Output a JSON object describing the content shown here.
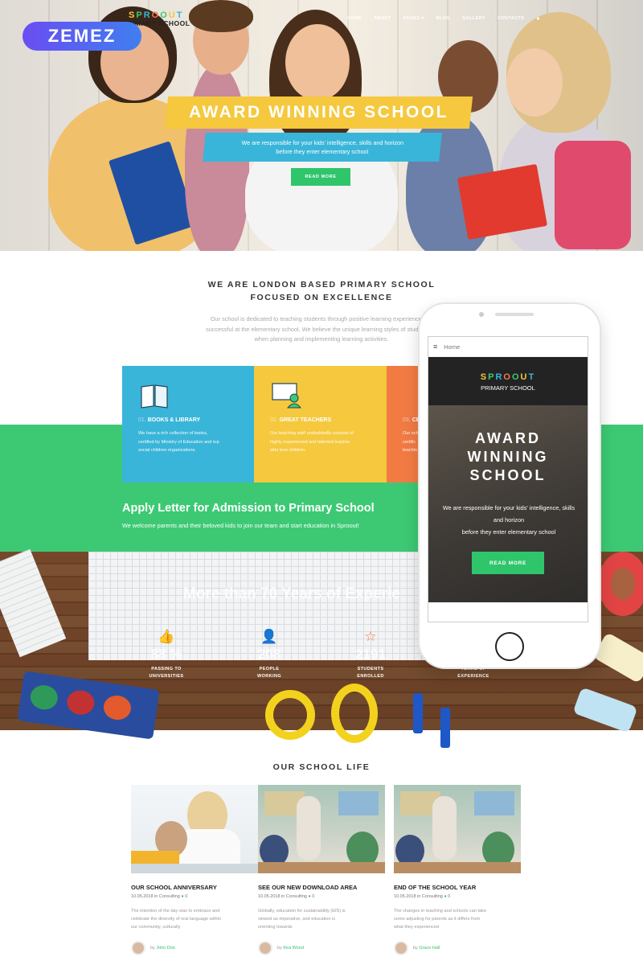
{
  "colors": {
    "green": "#3dc973",
    "yellow": "#f5c83e",
    "blue": "#39b5d9",
    "orange": "#f27b44",
    "zemez": "#5a5ff0"
  },
  "badge": {
    "text": "ZEMEZ"
  },
  "logo": {
    "letters": [
      "S",
      "P",
      "R",
      "O",
      "O",
      "U",
      "T"
    ],
    "letter_colors": [
      "#f5c83e",
      "#3dc973",
      "#39b5d9",
      "#f27b44",
      "#3dc973",
      "#f5c83e",
      "#39b5d9"
    ],
    "subtitle": "PRIMARY SCHOOL"
  },
  "nav": {
    "items": [
      "HOME",
      "ABOUT",
      "PAGES ▾",
      "BLOG",
      "GALLERY",
      "CONTACTS"
    ],
    "user_icon": "user-icon"
  },
  "hero": {
    "title": "AWARD WINNING SCHOOL",
    "sub_line1": "We are responsible for your kids' intelligence, skills and horizon",
    "sub_line2": "before they enter elementary school",
    "button": "READ MORE"
  },
  "about": {
    "title_line1": "WE ARE LONDON BASED PRIMARY SCHOOL",
    "title_line2": "FOCUSED ON EXCELLENCE",
    "text_line1": "Our school is dedicated to teaching students through positive learning experiences so",
    "text_line2": "successful at the elementary school. We believe the unique learning styles of students sh",
    "text_line3": "when planning and implementing learning activities."
  },
  "features": [
    {
      "num": "01.",
      "title": "BOOKS & LIBRARY",
      "line1": "We have a rich collection of books,",
      "line2": "certified by Ministry of Education and top",
      "line3": "social children organizations.",
      "icon": "book-icon"
    },
    {
      "num": "02.",
      "title": "GREAT TEACHERS",
      "line1": "Our teaching staff undoubtedly consists of",
      "line2": "highly experienced and talented teacher",
      "line3": "who love children.",
      "icon": "teacher-icon"
    },
    {
      "num": "03.",
      "title": "CE",
      "line1": "Our sch",
      "line2": "certific",
      "line3": "teachin",
      "icon": "award-icon"
    }
  ],
  "apply": {
    "title": "Apply Letter for Admission to Primary School",
    "text": "We welcome parents and their beloved kids to join our team and start education in Sproout!"
  },
  "experience": {
    "title": "More than 70 Years of Experie"
  },
  "stats": [
    {
      "value": "88 %",
      "label1": "PASSING TO",
      "label2": "UNIVERSITIES",
      "icon": "thumbs-up-icon",
      "glyph": "👍"
    },
    {
      "value": "208",
      "label1": "PEOPLE",
      "label2": "WORKING",
      "icon": "person-icon",
      "glyph": "👤"
    },
    {
      "value": "2191",
      "label1": "STUDENTS",
      "label2": "ENROLLED",
      "icon": "star-icon",
      "glyph": "☆"
    },
    {
      "value": "",
      "label1": "YEARS OF",
      "label2": "EXPERIENCE",
      "icon": "calendar-icon",
      "glyph": ""
    }
  ],
  "phone": {
    "menu_label": "Home",
    "logo_subtitle": "PRIMARY SCHOOL",
    "title_line1": "AWARD",
    "title_line2": "WINNING",
    "title_line3": "SCHOOL",
    "desc_line1": "We are responsible for your kids' intelligence, skills",
    "desc_line2": "and horizon",
    "desc_line3": "before they enter elementary school",
    "button": "READ MORE"
  },
  "life": {
    "title": "OUR SCHOOL LIFE",
    "posts": [
      {
        "title": "OUR SCHOOL ANNIVERSARY",
        "date": "10.05.2018",
        "category": "Consulting",
        "comments": "0",
        "line1": "The intention of the day was to embrace and",
        "line2": "celebrate the diversity of oral language within",
        "line3": "our community, culturally",
        "author": "John Doe"
      },
      {
        "title": "SEE OUR NEW DOWNLOAD AREA",
        "date": "10.05.2018",
        "category": "Consulting",
        "comments": "0",
        "line1": "Globally, education for sustainability (EfS) is",
        "line2": "viewed as imperative, and education is",
        "line3": "orienting towards",
        "author": "Kira Wood"
      },
      {
        "title": "END OF THE SCHOOL YEAR",
        "date": "10.05.2018",
        "category": "Consulting",
        "comments": "0",
        "line1": "The changes in teaching and schools can take",
        "line2": "some adjusting for parents as it differs from",
        "line3": "what they experienced",
        "author": "Grace Hall"
      }
    ]
  }
}
